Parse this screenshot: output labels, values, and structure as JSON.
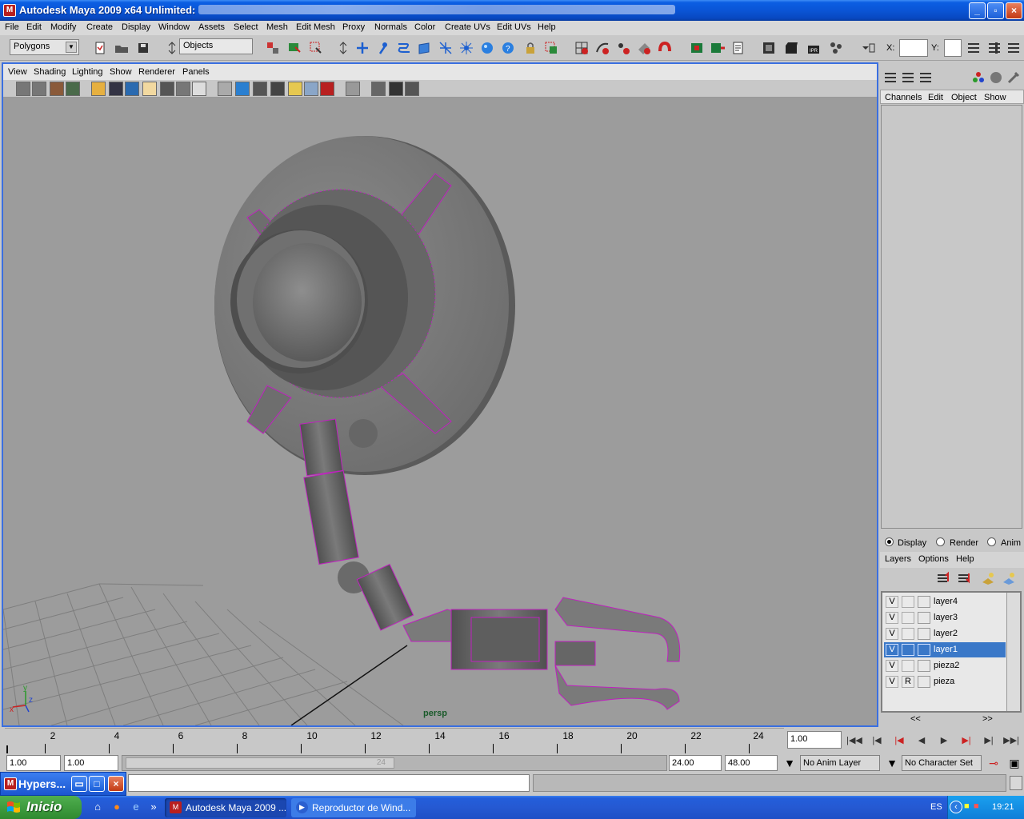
{
  "window": {
    "title": "Autodesk Maya 2009 x64 Unlimited:",
    "path_redacted": "",
    "controls": [
      "_",
      "▫",
      "×"
    ]
  },
  "menubar": [
    "File",
    "Edit",
    "Modify",
    "Create",
    "Display",
    "Window",
    "Assets",
    "Select",
    "Mesh",
    "Edit Mesh",
    "Proxy",
    "Normals",
    "Color",
    "Create UVs",
    "Edit UVs",
    "Help"
  ],
  "statusline": {
    "menuset": "Polygons",
    "selection_mode": "Objects",
    "x_label": "X:",
    "y_label": "Y:"
  },
  "panel": {
    "menu": [
      "View",
      "Shading",
      "Lighting",
      "Show",
      "Renderer",
      "Panels"
    ],
    "camera_label": "persp",
    "axis": {
      "x": "x",
      "y": "y",
      "z": "z"
    }
  },
  "channelbox": {
    "menu": [
      "Channels",
      "Edit",
      "Object",
      "Show"
    ]
  },
  "layers": {
    "modes": [
      "Display",
      "Render",
      "Anim"
    ],
    "selected_mode": "Display",
    "menu": [
      "Layers",
      "Options",
      "Help"
    ],
    "items": [
      {
        "vis": "V",
        "ref": "",
        "name": "layer4",
        "selected": false
      },
      {
        "vis": "V",
        "ref": "",
        "name": "layer3",
        "selected": false
      },
      {
        "vis": "V",
        "ref": "",
        "name": "layer2",
        "selected": false
      },
      {
        "vis": "V",
        "ref": "",
        "name": "layer1",
        "selected": true
      },
      {
        "vis": "V",
        "ref": "",
        "name": "pieza2",
        "selected": false
      },
      {
        "vis": "V",
        "ref": "R",
        "name": "pieza",
        "selected": false
      }
    ],
    "nav_prev": "<<",
    "nav_next": ">>"
  },
  "timeline": {
    "labels": [
      "2",
      "4",
      "6",
      "8",
      "10",
      "12",
      "14",
      "16",
      "18",
      "20",
      "22",
      "24"
    ],
    "current_frame": "1.00"
  },
  "range": {
    "start_time": "1.00",
    "playback_start": "1.00",
    "handle_end_label": "24",
    "playback_end": "24.00",
    "end_time": "48.00",
    "anim_layer": "No Anim Layer",
    "character_set": "No Character Set"
  },
  "hypershade": {
    "title": "Hypers..."
  },
  "taskbar": {
    "start": "Inicio",
    "tasks": [
      "Autodesk Maya 2009 ...",
      "Reproductor de Wind..."
    ],
    "lang": "ES",
    "clock": "19:21"
  }
}
